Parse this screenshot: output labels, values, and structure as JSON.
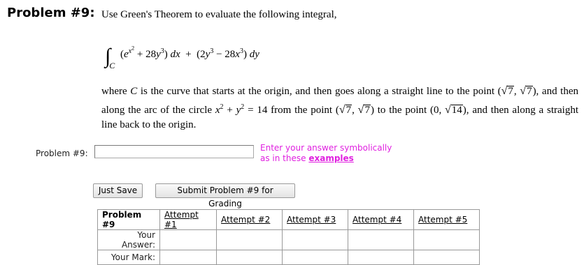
{
  "problem": {
    "heading": "Problem #9:",
    "intro": "Use Green's Theorem to evaluate the following integral,",
    "description_a": "where ",
    "description_b": " is the curve that starts at the origin, and then goes along a straight line to the point (",
    "description_c": "), and then along the arc of the circle ",
    "description_d": " from the point (",
    "description_e": ") to the point (0, ",
    "description_f": "), and then along a straight line back to the origin."
  },
  "answer": {
    "label": "Problem #9:",
    "input_value": "",
    "hint_line1": "Enter your answer symbolically",
    "hint_line2": "as in these",
    "hint_link": "examples"
  },
  "buttons": {
    "save": "Just Save",
    "submit": "Submit Problem #9 for Grading"
  },
  "attempts_table": {
    "header": "Problem #9",
    "attempts": [
      "Attempt #1",
      "Attempt #2",
      "Attempt #3",
      "Attempt #4",
      "Attempt #5"
    ],
    "row_answer": "Your Answer:",
    "row_mark": "Your Mark:"
  }
}
